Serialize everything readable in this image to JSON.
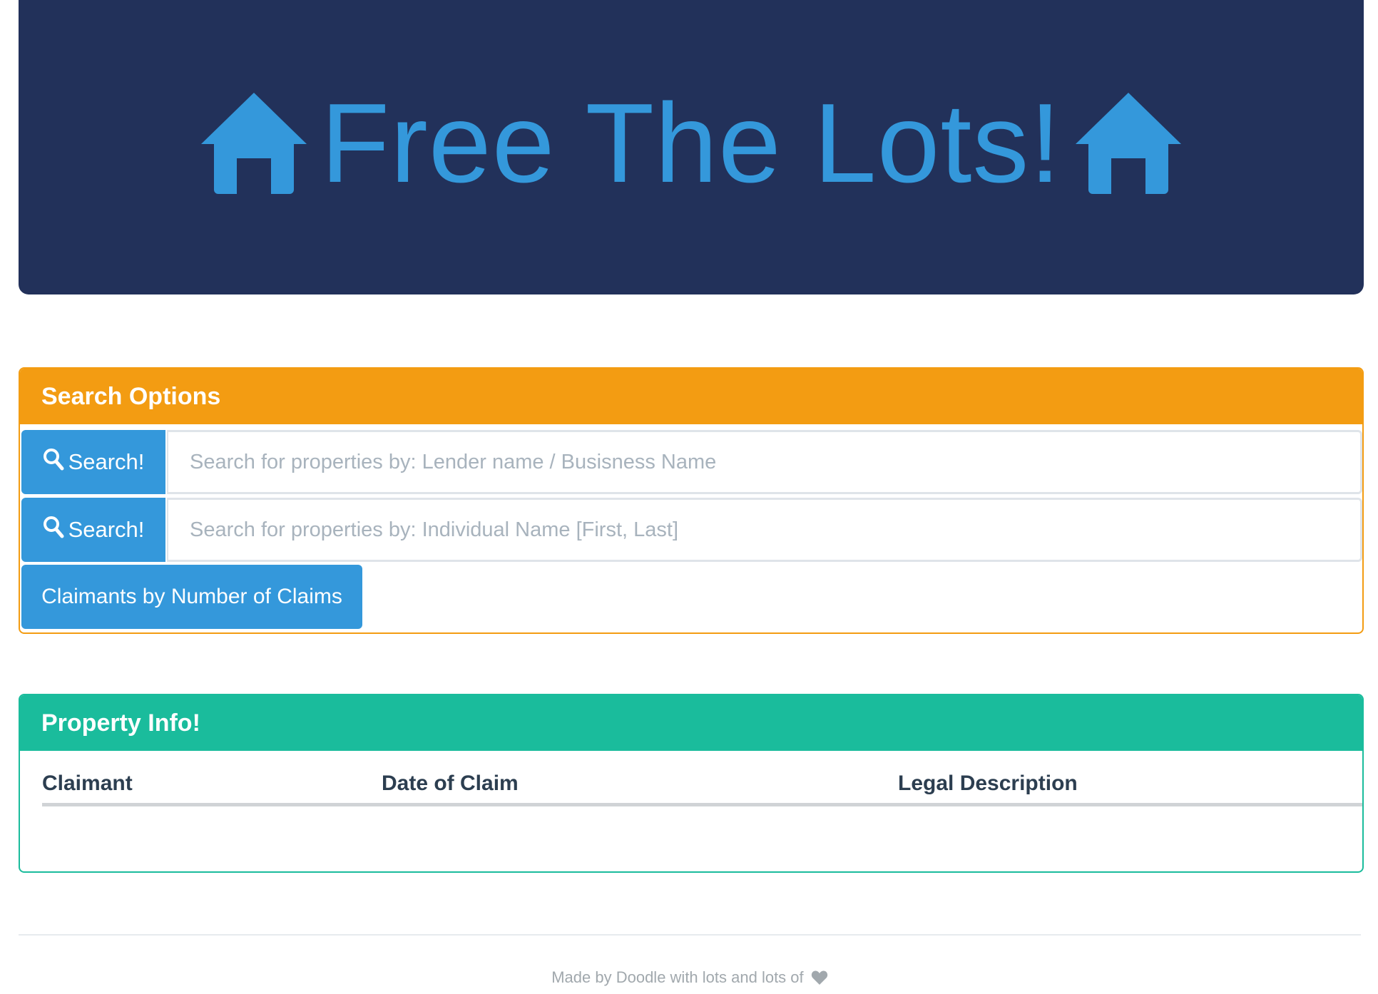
{
  "header": {
    "title": "Free The Lots!",
    "left_icon": "home-icon",
    "right_icon": "home-icon",
    "background_color": "#22315a",
    "accent_color": "#3498db"
  },
  "search_panel": {
    "heading": "Search Options",
    "header_color": "#f39c12",
    "rows": [
      {
        "button_label": "Search!",
        "button_icon": "search-icon",
        "input_value": "",
        "placeholder": "Search for properties by: Lender name / Busisness Name"
      },
      {
        "button_label": "Search!",
        "button_icon": "search-icon",
        "input_value": "",
        "placeholder": "Search for properties by: Individual Name [First, Last]"
      }
    ],
    "claimants_button_label": "Claimants by Number of Claims"
  },
  "property_panel": {
    "heading": "Property Info!",
    "header_color": "#1abc9c",
    "columns": [
      "Claimant",
      "Date of Claim",
      "Legal Description"
    ],
    "rows": []
  },
  "footer": {
    "text": "Made by Doodle with lots and lots of",
    "icon": "heart-icon"
  }
}
